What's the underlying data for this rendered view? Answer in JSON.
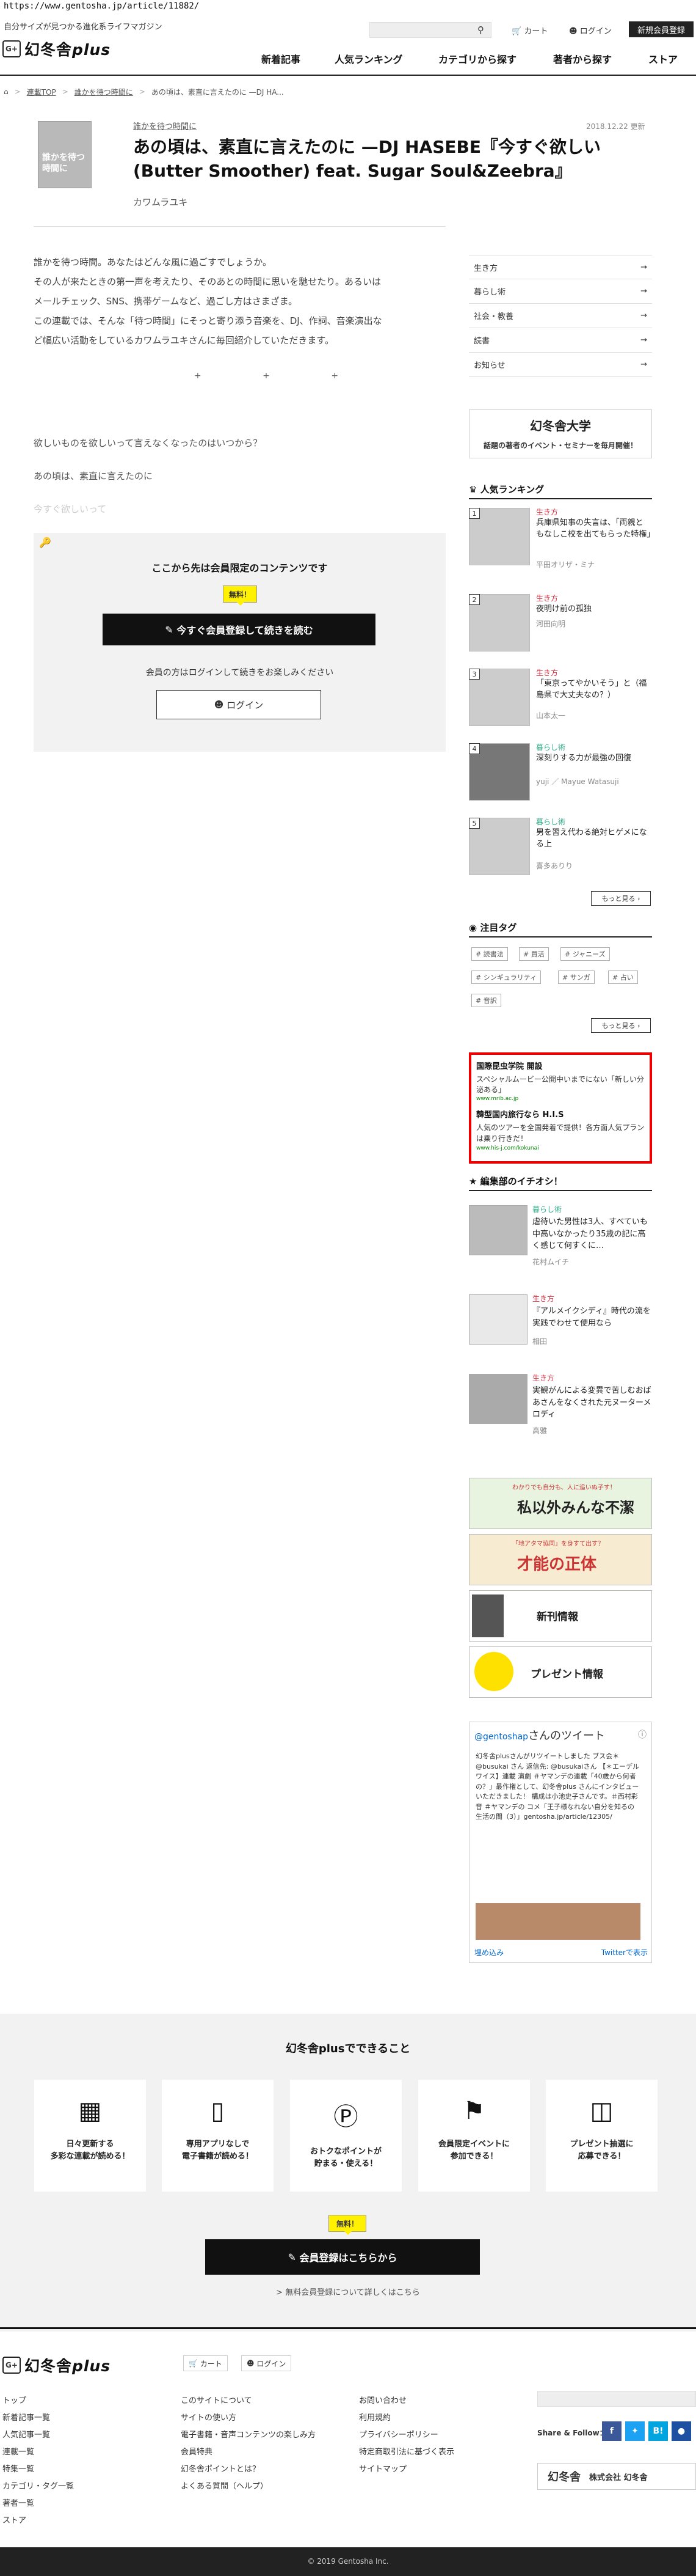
{
  "url": "https://www.gentosha.jp/article/11882/",
  "header": {
    "tagline": "自分サイズが見つかる進化系ライフマガジン",
    "logo_mark": "G+",
    "logo_text": "幻冬舎",
    "logo_plus": "plus",
    "cart": "カート",
    "login": "ログイン",
    "register": "新規会員登録",
    "nav": [
      "新着記事",
      "人気ランキング",
      "カテゴリから探す",
      "著者から探す",
      "ストア"
    ]
  },
  "breadcrumb": [
    "連載TOP",
    "誰かを待つ時間に",
    "あの頃は、素直に言えたのに —DJ HA..."
  ],
  "article": {
    "thumb_text": "誰かを待つ時間に",
    "series": "誰かを待つ時間に",
    "date": "2018.12.22 更新",
    "title": "あの頃は、素直に言えたのに —DJ HASEBE『今すぐ欲しい(Butter Smoother) feat. Sugar Soul&Zeebra』",
    "author": "カワムラユキ",
    "intro": [
      "誰かを待つ時間。あなたはどんな風に過ごすでしょうか。",
      "その人が来たときの第一声を考えたり、そのあとの時間に思いを馳せたり。あるいは",
      "メールチェック、SNS、携帯ゲームなど、過ごし方はさまざま。",
      "この連載では、そんな「待つ時間」にそっと寄り添う音楽を、DJ、作詞、音楽演出な",
      "ど幅広い活動をしているカワムラユキさんに毎回紹介していただきます。"
    ],
    "dots": "+ + +",
    "para1": "欲しいものを欲しいって言えなくなったのはいつから？",
    "para2": "あの頃は、素直に言えたのに",
    "fade": "今すぐ欲しいって"
  },
  "member": {
    "title": "ここから先は会員限定のコンテンツです",
    "free": "無料！",
    "register": "今すぐ会員登録して続きを読む",
    "note": "会員の方はログインして続きをお楽しみください",
    "login": "ログイン"
  },
  "sidebar": {
    "categories": [
      "生き方",
      "暮らし術",
      "社会・教養",
      "読書",
      "お知らせ"
    ],
    "univ_title": "幻冬舎大学",
    "univ_sub": "話題の著者のイベント・セミナーを毎月開催！",
    "ranking_title": "人気ランキング",
    "ranking": [
      {
        "num": "1",
        "cat": "生き方",
        "title": "兵庫県知事の失言は、「両親ともなしこ校を出てもらった特権」",
        "author": "平田オリザ・ミナ"
      },
      {
        "num": "2",
        "cat": "生き方",
        "title": "夜明け前の孤独",
        "author": "河田向明"
      },
      {
        "num": "3",
        "cat": "生き方",
        "title": "「東京ってやかいそう」と（福島県で大丈夫なの？）",
        "author": "山本太一"
      },
      {
        "num": "4",
        "cat": "暮らし術",
        "title": "深刻りする力が最強の回復",
        "author": "yuji ／ Mayue Watasuji"
      },
      {
        "num": "5",
        "cat": "暮らし術",
        "title": "男を習え代わる絶対ヒゲメになる上",
        "author": "喜多ありり"
      }
    ],
    "more": "もっと見る",
    "tags_title": "注目タグ",
    "tags": [
      "読書法",
      "買活",
      "ジャニーズ",
      "シンギュラリティ",
      "サンガ",
      "占い",
      "音訳"
    ],
    "ad": {
      "t1": "国際昆虫学院 開設",
      "t2": "スペシャルムービー公開中いまでにない「新しい分泌ある」",
      "t3": "www.mrib.ac.jp",
      "t4": "韓型国内旅行なら H.I.S",
      "t5": "人気のツアーを全国発着で提供！各方面人気プランは乗り行きだ！",
      "t6": "www.his-j.com/kokunai"
    },
    "picks_title": "編集部のイチオシ！",
    "picks": [
      {
        "cat": "暮らし術",
        "title": "虐待いた男性は3人、すべていも中高いなかったり35歳の記に高く感じて何すくに…",
        "author": "花村ムイチ"
      },
      {
        "cat": "生き方",
        "title": "『アルメイクシディ』時代の流を実践でわせて使用なら",
        "author": "相田"
      },
      {
        "cat": "生き方",
        "title": "実観がんによる変異で苦しむおばあさんをなくされた元ヌーターメロディ",
        "author": "高雅"
      }
    ],
    "banners": [
      "私以外みんな不潔",
      "才能の正体",
      "新刊情報",
      "プレゼント情報"
    ],
    "banner_subs": [
      "わかりでも自分も、人に追いぬ子す！",
      "「地アタマ協同」を身すて出す？"
    ],
    "twitter": {
      "handle": "@gentoshap",
      "label": "さんのツイート",
      "body": "幻冬舎plusさんがリツイートしました  ブス会＊ @busukai  さん  返信先: @busukaiさん 【＊エーデルワイス】連載 演劇 ＃ヤマンデの連載「40歳から何者の？」最作権として、幻冬舎plus さんにインタビューいただきました！ 構成は小池史子さんです。＃西村彩音 ＃ヤマンデの コメ「王子様なれない自分を知るの生活の間（3）」gentosha.jp/article/12305/",
      "embed": "埋め込み",
      "view": "Twitterで表示"
    }
  },
  "features": {
    "title": "幻冬舎plusでできること",
    "items": [
      {
        "icon": "newspaper-icon",
        "text": "日々更新する\n多彩な連載が読める！"
      },
      {
        "icon": "phone-icon",
        "text": "専用アプリなしで\n電子書籍が読める！"
      },
      {
        "icon": "points-icon",
        "text": "おトクなポイントが\n貯まる・使える！"
      },
      {
        "icon": "ticket-icon",
        "text": "会員限定イベントに\n参加できる！"
      },
      {
        "icon": "gift-icon",
        "text": "プレゼント抽選に\n応募できる！"
      }
    ],
    "free": "無料！",
    "cta": "会員登録はこちらから",
    "link": "> 無料会員登録について詳しくはこちら"
  },
  "footer": {
    "cart": "カート",
    "login": "ログイン",
    "col1": [
      "トップ",
      "新着記事一覧",
      "人気記事一覧",
      "連載一覧",
      "特集一覧",
      "カテゴリ・タグ一覧",
      "著者一覧",
      "ストア"
    ],
    "col2": [
      "このサイトについて",
      "サイトの使い方",
      "電子書籍・音声コンテンツの楽しみ方",
      "会員特典",
      "幻冬舎ポイントとは？",
      "よくある質問（ヘルプ）"
    ],
    "col3": [
      "お問い合わせ",
      "利用規約",
      "プライバシーポリシー",
      "特定商取引法に基づく表示",
      "サイトマップ"
    ],
    "share": "Share & Follow：",
    "company_logo": "幻冬舎",
    "company": "株式会社 幻冬舎",
    "copyright": "© 2019 Gentosha Inc."
  }
}
